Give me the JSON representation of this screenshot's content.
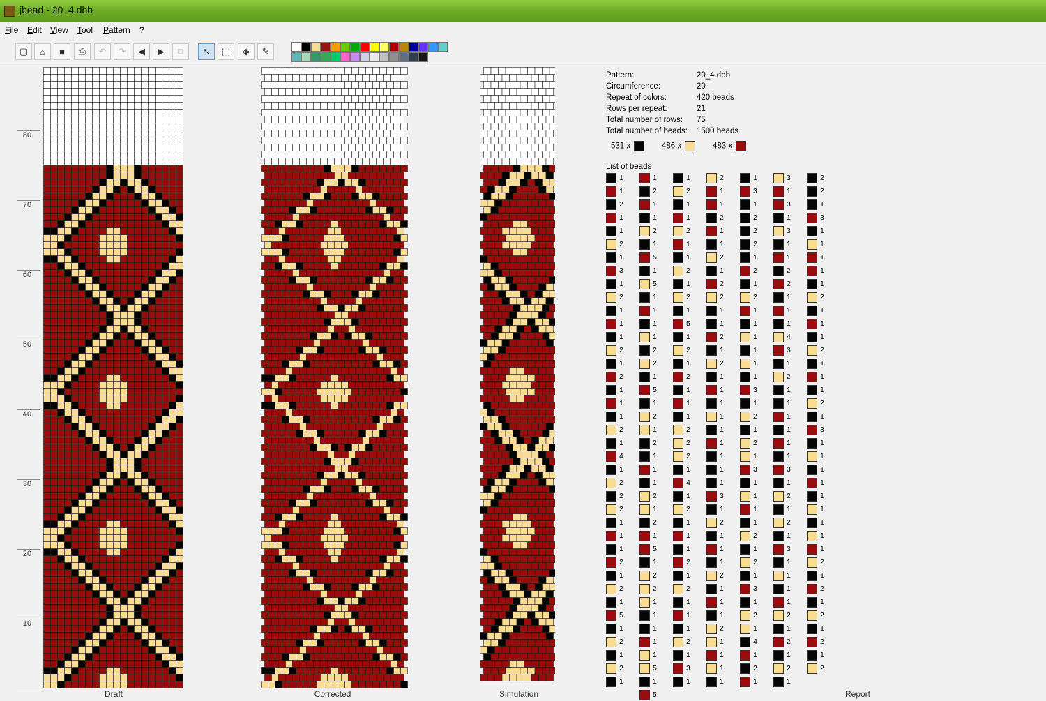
{
  "window": {
    "title": "jbead - 20_4.dbb"
  },
  "menu": [
    "File",
    "Edit",
    "View",
    "Tool",
    "Pattern",
    "?"
  ],
  "toolbar": {
    "buttons": [
      {
        "name": "new-file-button",
        "glyph": "▢"
      },
      {
        "name": "open-button",
        "glyph": "⌂"
      },
      {
        "name": "save-button",
        "glyph": "■"
      },
      {
        "name": "print-button",
        "glyph": "⎙"
      },
      {
        "name": "undo-button",
        "glyph": "↶",
        "disabled": true
      },
      {
        "name": "redo-button",
        "glyph": "↷",
        "disabled": true
      },
      {
        "name": "arrow-left-button",
        "glyph": "◀"
      },
      {
        "name": "arrow-right-button",
        "glyph": "▶"
      },
      {
        "name": "copy-button",
        "glyph": "⧉",
        "disabled": true
      },
      {
        "name": "select-tool-button",
        "glyph": "↖",
        "active": true
      },
      {
        "name": "rect-select-button",
        "glyph": "⬚"
      },
      {
        "name": "fill-tool-button",
        "glyph": "◈"
      },
      {
        "name": "pipette-tool-button",
        "glyph": "✎"
      }
    ]
  },
  "palette": {
    "row1": [
      "#ffffff",
      "#000000",
      "#f5dd96",
      "#9b1111",
      "#ff9900",
      "#66cc00",
      "#00aa00",
      "#ff0000",
      "#ffff00",
      "#ffff66",
      "#aa0000",
      "#b8860b",
      "#000099",
      "#6633ff",
      "#3399ff",
      "#66cccc"
    ],
    "row2": [
      "#5fb8b8",
      "#a8d8b8",
      "#339966",
      "#33aa55",
      "#00cc66",
      "#ff66cc",
      "#cc88ee",
      "#cfcfe6",
      "#e8e8e8",
      "#c0c0c0",
      "#909090",
      "#607080",
      "#304050",
      "#181818"
    ]
  },
  "colors": {
    "black": "#050505",
    "cream": "#f8dc93",
    "red": "#9a0c0c",
    "white": "#ffffff"
  },
  "ruler": [
    "80",
    "70",
    "60",
    "50",
    "40",
    "30",
    "20",
    "10"
  ],
  "panels": {
    "draft": "Draft",
    "corrected": "Corrected",
    "simulation": "Simulation",
    "report": "Report"
  },
  "report": {
    "pattern_label": "Pattern:",
    "pattern_value": "20_4.dbb",
    "circumference_label": "Circumference:",
    "circumference_value": "20",
    "repeat_label": "Repeat of colors:",
    "repeat_value": "420 beads",
    "rows_per_repeat_label": "Rows per repeat:",
    "rows_per_repeat_value": "21",
    "total_rows_label": "Total number of rows:",
    "total_rows_value": "75",
    "total_beads_label": "Total number of beads:",
    "total_beads_value": "1500 beads",
    "counts": [
      {
        "text": "531 x",
        "color": "black"
      },
      {
        "text": "486 x",
        "color": "cream"
      },
      {
        "text": "483 x",
        "color": "red"
      }
    ],
    "list_title": "List of beads"
  },
  "bead_list": [
    [
      [
        "K",
        1
      ],
      [
        "R",
        1
      ],
      [
        "K",
        2
      ],
      [
        "R",
        1
      ],
      [
        "K",
        1
      ],
      [
        "C",
        2
      ],
      [
        "K",
        1
      ],
      [
        "R",
        3
      ],
      [
        "K",
        1
      ],
      [
        "C",
        2
      ],
      [
        "K",
        1
      ],
      [
        "R",
        1
      ],
      [
        "K",
        1
      ],
      [
        "C",
        2
      ],
      [
        "K",
        1
      ],
      [
        "R",
        2
      ],
      [
        "K",
        1
      ],
      [
        "R",
        1
      ],
      [
        "K",
        1
      ],
      [
        "C",
        2
      ],
      [
        "K",
        1
      ],
      [
        "R",
        4
      ],
      [
        "K",
        1
      ],
      [
        "C",
        2
      ],
      [
        "K",
        2
      ],
      [
        "C",
        2
      ],
      [
        "K",
        1
      ],
      [
        "R",
        1
      ],
      [
        "K",
        1
      ],
      [
        "R",
        2
      ],
      [
        "K",
        1
      ],
      [
        "C",
        2
      ],
      [
        "K",
        1
      ],
      [
        "R",
        5
      ],
      [
        "K",
        1
      ],
      [
        "C",
        2
      ],
      [
        "K",
        1
      ],
      [
        "C",
        2
      ],
      [
        "K",
        1
      ]
    ],
    [
      [
        "R",
        1
      ],
      [
        "K",
        2
      ],
      [
        "R",
        1
      ],
      [
        "K",
        1
      ],
      [
        "C",
        2
      ],
      [
        "K",
        1
      ],
      [
        "R",
        5
      ],
      [
        "K",
        1
      ],
      [
        "C",
        5
      ],
      [
        "K",
        1
      ],
      [
        "R",
        1
      ],
      [
        "K",
        1
      ],
      [
        "C",
        1
      ],
      [
        "K",
        2
      ],
      [
        "C",
        2
      ],
      [
        "K",
        1
      ],
      [
        "R",
        5
      ],
      [
        "K",
        1
      ],
      [
        "C",
        2
      ],
      [
        "C",
        1
      ],
      [
        "K",
        2
      ],
      [
        "K",
        1
      ],
      [
        "R",
        1
      ],
      [
        "K",
        1
      ],
      [
        "C",
        2
      ],
      [
        "C",
        1
      ],
      [
        "K",
        2
      ],
      [
        "R",
        1
      ],
      [
        "R",
        5
      ],
      [
        "K",
        1
      ],
      [
        "C",
        2
      ],
      [
        "C",
        2
      ],
      [
        "C",
        1
      ],
      [
        "K",
        1
      ],
      [
        "K",
        1
      ],
      [
        "R",
        1
      ],
      [
        "C",
        1
      ],
      [
        "C",
        5
      ],
      [
        "K",
        1
      ],
      [
        "R",
        5
      ]
    ],
    [
      [
        "K",
        1
      ],
      [
        "C",
        2
      ],
      [
        "K",
        1
      ],
      [
        "R",
        1
      ],
      [
        "C",
        2
      ],
      [
        "R",
        1
      ],
      [
        "K",
        1
      ],
      [
        "C",
        2
      ],
      [
        "K",
        1
      ],
      [
        "C",
        2
      ],
      [
        "K",
        1
      ],
      [
        "R",
        5
      ],
      [
        "K",
        1
      ],
      [
        "C",
        2
      ],
      [
        "K",
        1
      ],
      [
        "R",
        2
      ],
      [
        "K",
        1
      ],
      [
        "R",
        1
      ],
      [
        "K",
        1
      ],
      [
        "C",
        2
      ],
      [
        "C",
        2
      ],
      [
        "C",
        2
      ],
      [
        "K",
        1
      ],
      [
        "R",
        4
      ],
      [
        "K",
        1
      ],
      [
        "C",
        2
      ],
      [
        "K",
        1
      ],
      [
        "R",
        1
      ],
      [
        "K",
        1
      ],
      [
        "R",
        2
      ],
      [
        "K",
        1
      ],
      [
        "C",
        2
      ],
      [
        "K",
        1
      ],
      [
        "R",
        1
      ],
      [
        "K",
        1
      ],
      [
        "C",
        2
      ],
      [
        "K",
        1
      ],
      [
        "R",
        3
      ],
      [
        "K",
        1
      ]
    ],
    [
      [
        "C",
        2
      ],
      [
        "R",
        1
      ],
      [
        "R",
        1
      ],
      [
        "K",
        2
      ],
      [
        "R",
        1
      ],
      [
        "K",
        1
      ],
      [
        "C",
        2
      ],
      [
        "K",
        1
      ],
      [
        "R",
        2
      ],
      [
        "C",
        2
      ],
      [
        "K",
        1
      ],
      [
        "K",
        1
      ],
      [
        "R",
        2
      ],
      [
        "K",
        1
      ],
      [
        "C",
        2
      ],
      [
        "K",
        1
      ],
      [
        "R",
        1
      ],
      [
        "K",
        1
      ],
      [
        "C",
        1
      ],
      [
        "K",
        1
      ],
      [
        "R",
        1
      ],
      [
        "K",
        1
      ],
      [
        "K",
        1
      ],
      [
        "K",
        1
      ],
      [
        "R",
        3
      ],
      [
        "K",
        1
      ],
      [
        "C",
        2
      ],
      [
        "K",
        1
      ],
      [
        "R",
        1
      ],
      [
        "K",
        1
      ],
      [
        "C",
        2
      ],
      [
        "K",
        1
      ],
      [
        "R",
        1
      ],
      [
        "K",
        1
      ],
      [
        "C",
        2
      ],
      [
        "C",
        1
      ],
      [
        "R",
        1
      ],
      [
        "C",
        1
      ],
      [
        "K",
        1
      ]
    ],
    [
      [
        "K",
        1
      ],
      [
        "R",
        3
      ],
      [
        "K",
        1
      ],
      [
        "K",
        2
      ],
      [
        "K",
        2
      ],
      [
        "K",
        2
      ],
      [
        "K",
        1
      ],
      [
        "R",
        2
      ],
      [
        "K",
        1
      ],
      [
        "C",
        2
      ],
      [
        "R",
        1
      ],
      [
        "K",
        1
      ],
      [
        "C",
        1
      ],
      [
        "K",
        1
      ],
      [
        "C",
        1
      ],
      [
        "K",
        1
      ],
      [
        "R",
        3
      ],
      [
        "K",
        1
      ],
      [
        "C",
        2
      ],
      [
        "K",
        1
      ],
      [
        "C",
        2
      ],
      [
        "C",
        1
      ],
      [
        "R",
        3
      ],
      [
        "K",
        1
      ],
      [
        "C",
        1
      ],
      [
        "R",
        1
      ],
      [
        "K",
        1
      ],
      [
        "C",
        2
      ],
      [
        "K",
        1
      ],
      [
        "C",
        2
      ],
      [
        "K",
        1
      ],
      [
        "R",
        3
      ],
      [
        "K",
        1
      ],
      [
        "C",
        2
      ],
      [
        "C",
        1
      ],
      [
        "K",
        4
      ],
      [
        "R",
        1
      ],
      [
        "K",
        2
      ],
      [
        "R",
        1
      ]
    ],
    [
      [
        "C",
        3
      ],
      [
        "R",
        1
      ],
      [
        "R",
        3
      ],
      [
        "K",
        1
      ],
      [
        "C",
        3
      ],
      [
        "K",
        1
      ],
      [
        "R",
        1
      ],
      [
        "K",
        2
      ],
      [
        "R",
        2
      ],
      [
        "K",
        1
      ],
      [
        "R",
        1
      ],
      [
        "K",
        1
      ],
      [
        "C",
        4
      ],
      [
        "R",
        3
      ],
      [
        "K",
        1
      ],
      [
        "C",
        2
      ],
      [
        "K",
        1
      ],
      [
        "K",
        1
      ],
      [
        "R",
        1
      ],
      [
        "K",
        1
      ],
      [
        "R",
        1
      ],
      [
        "K",
        1
      ],
      [
        "R",
        3
      ],
      [
        "K",
        1
      ],
      [
        "C",
        2
      ],
      [
        "K",
        1
      ],
      [
        "C",
        2
      ],
      [
        "K",
        1
      ],
      [
        "R",
        3
      ],
      [
        "K",
        1
      ],
      [
        "C",
        1
      ],
      [
        "K",
        1
      ],
      [
        "R",
        1
      ],
      [
        "C",
        2
      ],
      [
        "K",
        1
      ],
      [
        "R",
        2
      ],
      [
        "K",
        1
      ],
      [
        "C",
        2
      ],
      [
        "K",
        1
      ]
    ],
    [
      [
        "K",
        2
      ],
      [
        "K",
        2
      ],
      [
        "K",
        1
      ],
      [
        "R",
        3
      ],
      [
        "K",
        1
      ],
      [
        "C",
        1
      ],
      [
        "R",
        1
      ],
      [
        "R",
        1
      ],
      [
        "K",
        1
      ],
      [
        "C",
        2
      ],
      [
        "K",
        1
      ],
      [
        "R",
        1
      ],
      [
        "K",
        1
      ],
      [
        "C",
        2
      ],
      [
        "K",
        1
      ],
      [
        "R",
        1
      ],
      [
        "K",
        1
      ],
      [
        "C",
        2
      ],
      [
        "K",
        1
      ],
      [
        "R",
        3
      ],
      [
        "K",
        1
      ],
      [
        "C",
        1
      ],
      [
        "K",
        1
      ],
      [
        "R",
        1
      ],
      [
        "K",
        1
      ],
      [
        "C",
        1
      ],
      [
        "K",
        1
      ],
      [
        "C",
        1
      ],
      [
        "R",
        1
      ],
      [
        "C",
        2
      ],
      [
        "K",
        1
      ],
      [
        "R",
        2
      ],
      [
        "K",
        1
      ],
      [
        "C",
        2
      ],
      [
        "K",
        1
      ],
      [
        "R",
        2
      ],
      [
        "K",
        1
      ],
      [
        "C",
        2
      ]
    ]
  ]
}
